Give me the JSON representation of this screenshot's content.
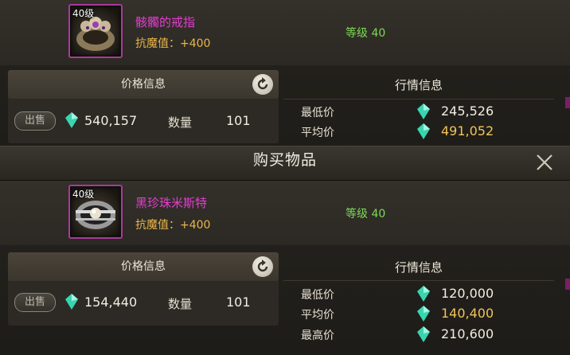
{
  "dialog": {
    "title": "购买物品"
  },
  "listings": [
    {
      "item": {
        "level_tag": "40级",
        "name": "骸髑的戒指",
        "resist": "抗魔值：+400",
        "required_level": "等级 40",
        "icon": "skull-ring-icon"
      },
      "price": {
        "header": "价格信息",
        "sell_label": "出售",
        "amount": "540,157",
        "qty_label": "数量",
        "qty": "101"
      },
      "market": {
        "header": "行情信息",
        "rows": [
          {
            "label": "最低价",
            "value": "245,526"
          },
          {
            "label": "平均价",
            "value": "491,052"
          }
        ]
      }
    },
    {
      "item": {
        "level_tag": "40级",
        "name": "黑珍珠米斯特",
        "resist": "抗魔值：+400",
        "required_level": "等级 40",
        "icon": "black-pearl-ring-icon"
      },
      "price": {
        "header": "价格信息",
        "sell_label": "出售",
        "amount": "154,440",
        "qty_label": "数量",
        "qty": "101"
      },
      "market": {
        "header": "行情信息",
        "rows": [
          {
            "label": "最低价",
            "value": "120,000"
          },
          {
            "label": "平均价",
            "value": "140,400"
          },
          {
            "label": "最高价",
            "value": "210,600"
          }
        ]
      }
    }
  ],
  "colors": {
    "item_name": "#e23fcf",
    "resist": "#e8b64a",
    "required_level": "#7ed957",
    "average_price": "#f1c45a",
    "crystal": "#38d6b0"
  }
}
